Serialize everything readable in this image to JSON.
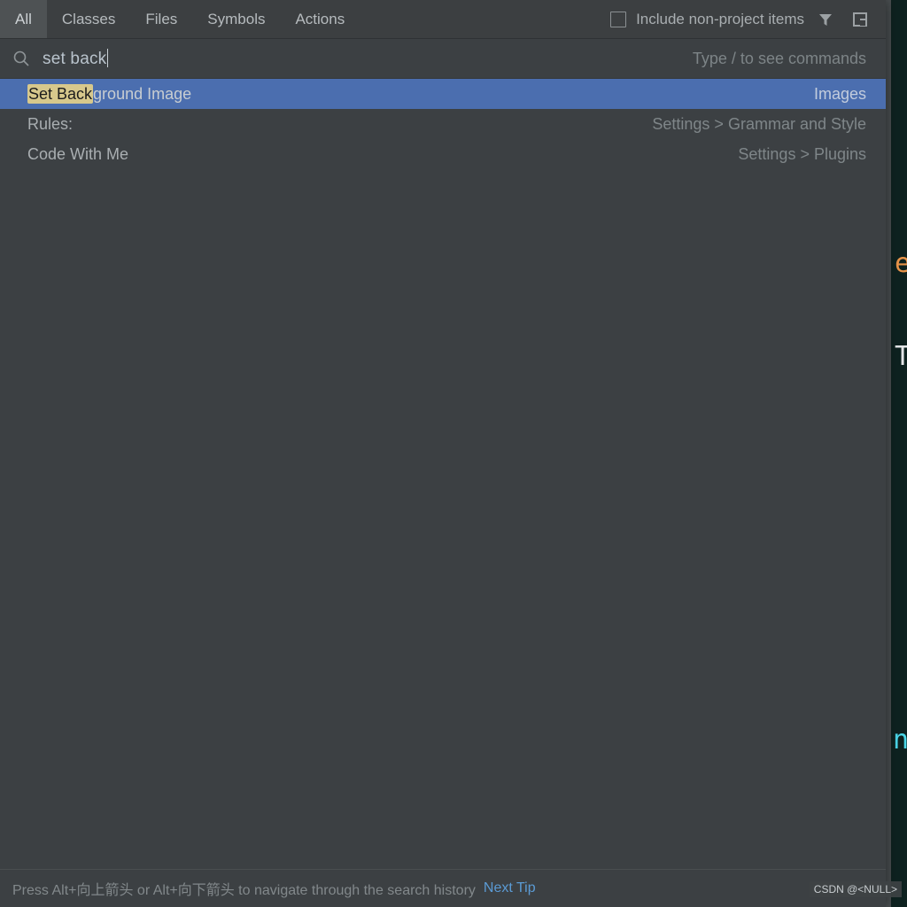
{
  "popup": {
    "tabs": [
      {
        "label": "All",
        "active": true
      },
      {
        "label": "Classes",
        "active": false
      },
      {
        "label": "Files",
        "active": false
      },
      {
        "label": "Symbols",
        "active": false
      },
      {
        "label": "Actions",
        "active": false
      }
    ],
    "non_project_checkbox": {
      "label": "Include non-project items",
      "checked": false
    },
    "header_icons": [
      {
        "name": "filter-icon"
      },
      {
        "name": "open-in-window-icon"
      }
    ],
    "search": {
      "icon": "search-icon",
      "value": "set back",
      "commands_hint": "Type / to see commands"
    },
    "results": [
      {
        "match": "Set Back",
        "rest": "ground Image",
        "location": "Images",
        "selected": true
      },
      {
        "match": "",
        "rest": "Rules:",
        "location": "Settings > Grammar and Style",
        "selected": false
      },
      {
        "match": "",
        "rest": "Code With Me",
        "location": "Settings > Plugins",
        "selected": false
      }
    ],
    "tip": {
      "text": "Press Alt+向上箭头 or Alt+向下箭头 to navigate through the search history",
      "link": "Next Tip"
    }
  },
  "editor": {
    "visible_glyphs": [
      "e",
      "T",
      "n"
    ]
  },
  "watermark": "CSDN @<NULL>",
  "colors": {
    "popup_bg": "#3c4043",
    "header_bg": "#3c3f41",
    "active_tab_bg": "#4e5254",
    "selection_blue": "#4b6eaf",
    "match_highlight": "#d7c88c",
    "link_blue": "#5b9bd5",
    "editor_bg": "#0e2220"
  }
}
